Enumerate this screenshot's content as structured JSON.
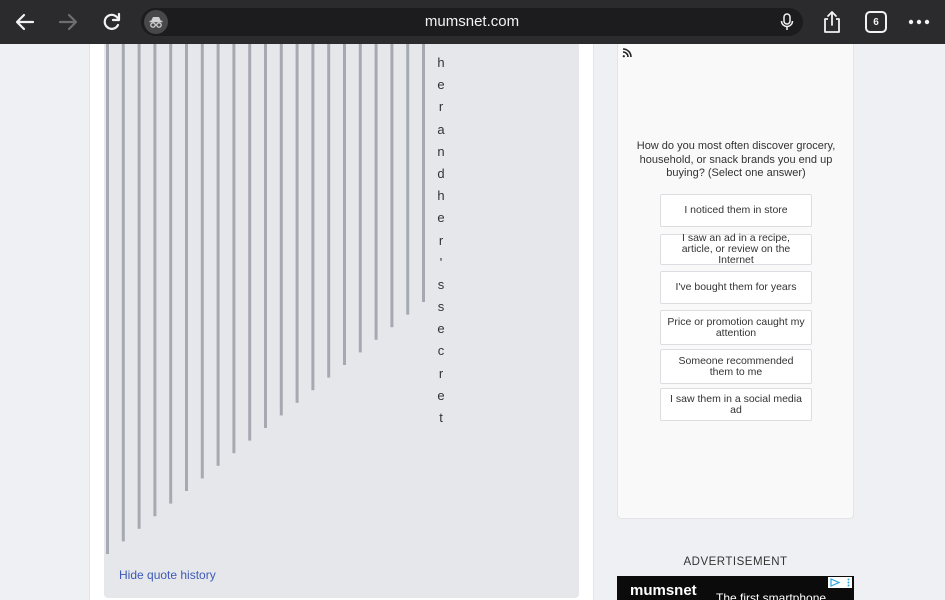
{
  "browser": {
    "url": "mumsnet.com",
    "tab_count": "6"
  },
  "thread": {
    "secret_letters": [
      "h",
      "e",
      "r",
      "a",
      "n",
      "d",
      "h",
      "e",
      "r",
      "'",
      "s",
      "s",
      "e",
      "c",
      "r",
      "e",
      "t"
    ],
    "hide_quote_history": "Hide quote history"
  },
  "poll": {
    "question": "How do you most often discover grocery, household, or snack brands you end up buying? (Select one answer)",
    "options": [
      "I noticed them in store",
      "I saw an ad in a recipe, article, or review on the Internet",
      "I've bought them for years",
      "Price or promotion caught my attention",
      "Someone recommended them to me",
      "I saw them in a social media ad"
    ]
  },
  "advertisement": {
    "label": "ADVERTISEMENT",
    "brand": "mumsnet",
    "text": "The first smartphone"
  },
  "colors": {
    "toolbar": "#2b2b2d",
    "quote_line": "#a6a9b2",
    "link": "#3d5ab8"
  },
  "icons": [
    "back-arrow-icon",
    "forward-arrow-icon",
    "reload-icon",
    "incognito-icon",
    "microphone-icon",
    "share-icon",
    "tabs-icon",
    "more-icon",
    "rss-icon",
    "ad-choices-icon"
  ]
}
